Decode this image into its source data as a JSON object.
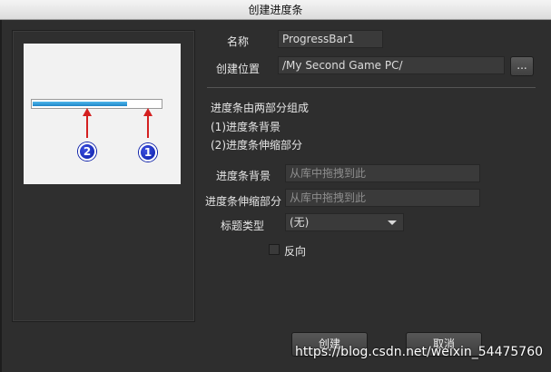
{
  "window": {
    "title": "创建进度条"
  },
  "form": {
    "name_label": "名称",
    "name_value": "ProgressBar1",
    "location_label": "创建位置",
    "location_value": "/My Second Game PC/",
    "browse_label": "...",
    "desc_line1": "进度条由两部分组成",
    "desc_line2": "(1)进度条背景",
    "desc_line3": "(2)进度条伸缩部分",
    "bg_label": "进度条背景",
    "bg_placeholder": "从库中拖拽到此",
    "stretch_label": "进度条伸缩部分",
    "stretch_placeholder": "从库中拖拽到此",
    "title_type_label": "标题类型",
    "title_type_value": "(无)",
    "reverse_label": "反向",
    "reverse_checked": false
  },
  "preview": {
    "progress_fraction": 0.74,
    "badge_1": "1",
    "badge_2": "2",
    "fill_color": "#1f86c8",
    "annotation_color": "#d42020",
    "badge_color": "#0b1fa8"
  },
  "buttons": {
    "create": "创建",
    "cancel": "取消"
  },
  "watermark": "https://blog.csdn.net/weixin_54475760"
}
